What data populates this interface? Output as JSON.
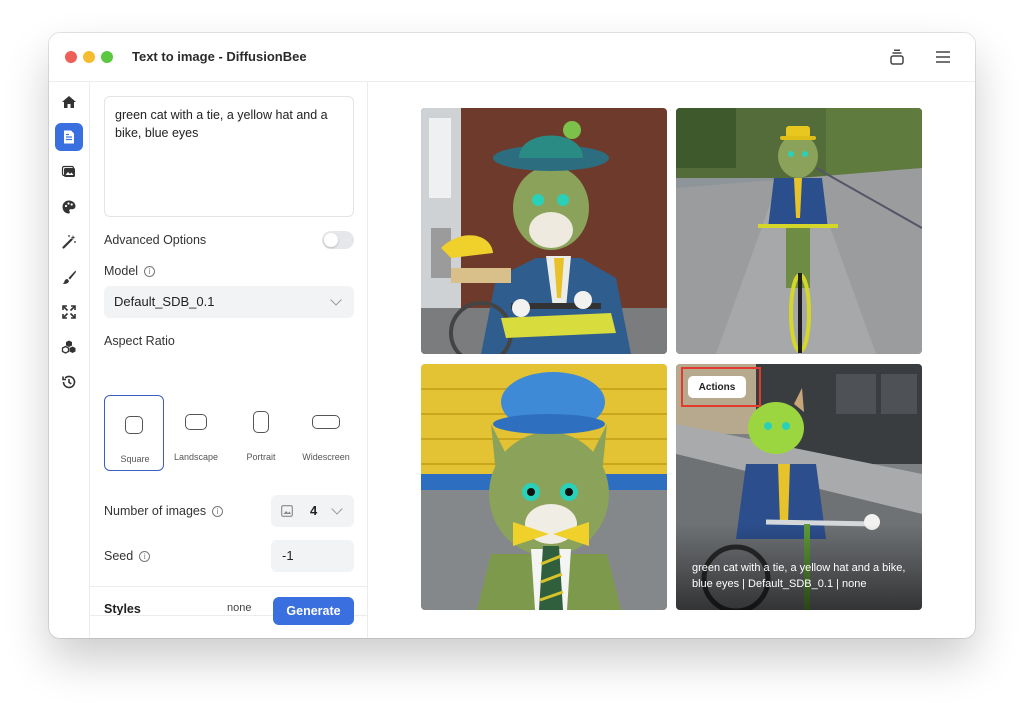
{
  "window": {
    "title": "Text to image - DiffusionBee",
    "titlebar_icons": [
      "stack-icon",
      "hamburger-menu-icon"
    ]
  },
  "rail": {
    "items": [
      "home-icon",
      "text-to-image-icon",
      "image-to-image-icon",
      "palette-icon",
      "magic-wand-icon",
      "brush-icon",
      "upscale-icon",
      "models-icon",
      "history-icon"
    ],
    "active_index": 1
  },
  "panel": {
    "prompt": "green cat with a tie, a yellow hat and a bike, blue eyes",
    "advanced_options_label": "Advanced Options",
    "advanced_options_on": false,
    "model_label": "Model",
    "model_value": "Default_SDB_0.1",
    "aspect_ratio_label": "Aspect Ratio",
    "aspect_ratios": [
      "Square",
      "Landscape",
      "Portrait",
      "Widescreen"
    ],
    "aspect_selected": "Square",
    "num_images_label": "Number of images",
    "num_images_value": "4",
    "seed_label": "Seed",
    "seed_value": "-1",
    "styles_label": "Styles",
    "styles_value": "none",
    "generate_label": "Generate"
  },
  "results": {
    "actions_label": "Actions",
    "caption": "green cat with a tie, a yellow hat and a bike, blue eyes | Default_SDB_0.1 | none"
  },
  "colors": {
    "accent": "#3a6fe0",
    "highlight_box": "#e23b2e"
  }
}
